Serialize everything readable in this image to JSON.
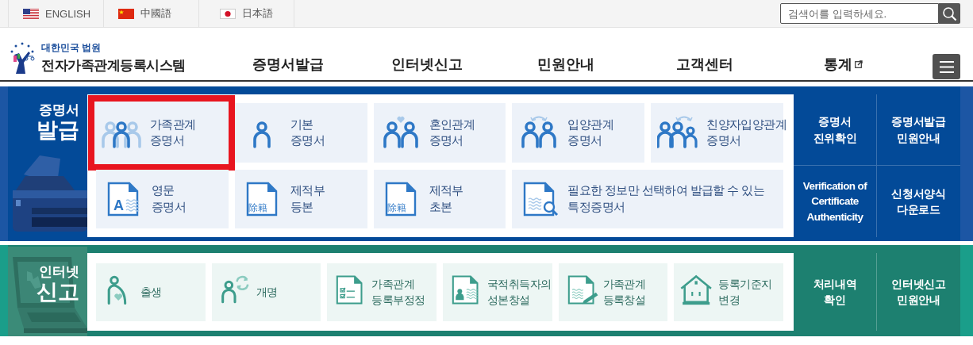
{
  "language_bar": {
    "languages": [
      {
        "label": "ENGLISH",
        "kind": "us"
      },
      {
        "label": "中國語",
        "kind": "cn"
      },
      {
        "label": "日本語",
        "kind": "jp"
      }
    ],
    "search": {
      "placeholder": "검색어를 입력하세요."
    }
  },
  "header": {
    "org": "대한민국 법원",
    "title": "전자가족관계등록시스템",
    "nav": [
      {
        "label": "증명서발급",
        "external": false
      },
      {
        "label": "인터넷신고",
        "external": false
      },
      {
        "label": "민원안내",
        "external": false
      },
      {
        "label": "고객센터",
        "external": false
      },
      {
        "label": "통계",
        "external": true
      }
    ]
  },
  "sections": [
    {
      "kind": "blue",
      "title_top": "증명서",
      "title_bottom": "발급",
      "tiles": [
        {
          "kind": "family",
          "label": "가족관계\n증명서",
          "selected": true
        },
        {
          "kind": "person",
          "label": "기본\n증명서",
          "selected": false
        },
        {
          "kind": "couple",
          "label": "혼인관계\n증명서",
          "selected": false
        },
        {
          "kind": "adoption",
          "label": "입양관계\n증명서",
          "selected": false
        },
        {
          "kind": "groupadoption",
          "label": "친양자입양관계\n증명서",
          "selected": false
        },
        {
          "kind": "english",
          "icon_text": "A",
          "label": "영문\n증명서",
          "selected": false
        },
        {
          "kind": "removed",
          "icon_text": "除籍",
          "label": "제적부\n등본",
          "selected": false
        },
        {
          "kind": "removed",
          "icon_text": "除籍",
          "label": "제적부\n초본",
          "selected": false
        },
        {
          "kind": "searchdoc",
          "label": "필요한 정보만 선택하여 발급할 수 있는\n특정증명서",
          "selected": false,
          "wide": true
        }
      ],
      "links": [
        {
          "label": "증명서\n진위확인"
        },
        {
          "label": "증명서발급\n민원안내"
        },
        {
          "label": "Verification of\nCertificate\nAuthenticity"
        },
        {
          "label": "신청서양식\n다운로드"
        }
      ]
    },
    {
      "kind": "green",
      "title_top": "인터넷",
      "title_bottom": "신고",
      "tiles": [
        {
          "kind": "birth",
          "label": "출생",
          "selected": false
        },
        {
          "kind": "rename",
          "label": "개명",
          "selected": false
        },
        {
          "kind": "checklist",
          "label": "가족관계\n등록부정정",
          "selected": false
        },
        {
          "kind": "iddoc",
          "label": "국적취득자의\n성본창설",
          "selected": false
        },
        {
          "kind": "editdoc",
          "label": "가족관계\n등록창설",
          "selected": false
        },
        {
          "kind": "house",
          "label": "등록기준지\n변경",
          "selected": false
        }
      ],
      "links": [
        {
          "label": "처리내역\n확인"
        },
        {
          "label": "인터넷신고\n민원안내"
        }
      ]
    }
  ]
}
